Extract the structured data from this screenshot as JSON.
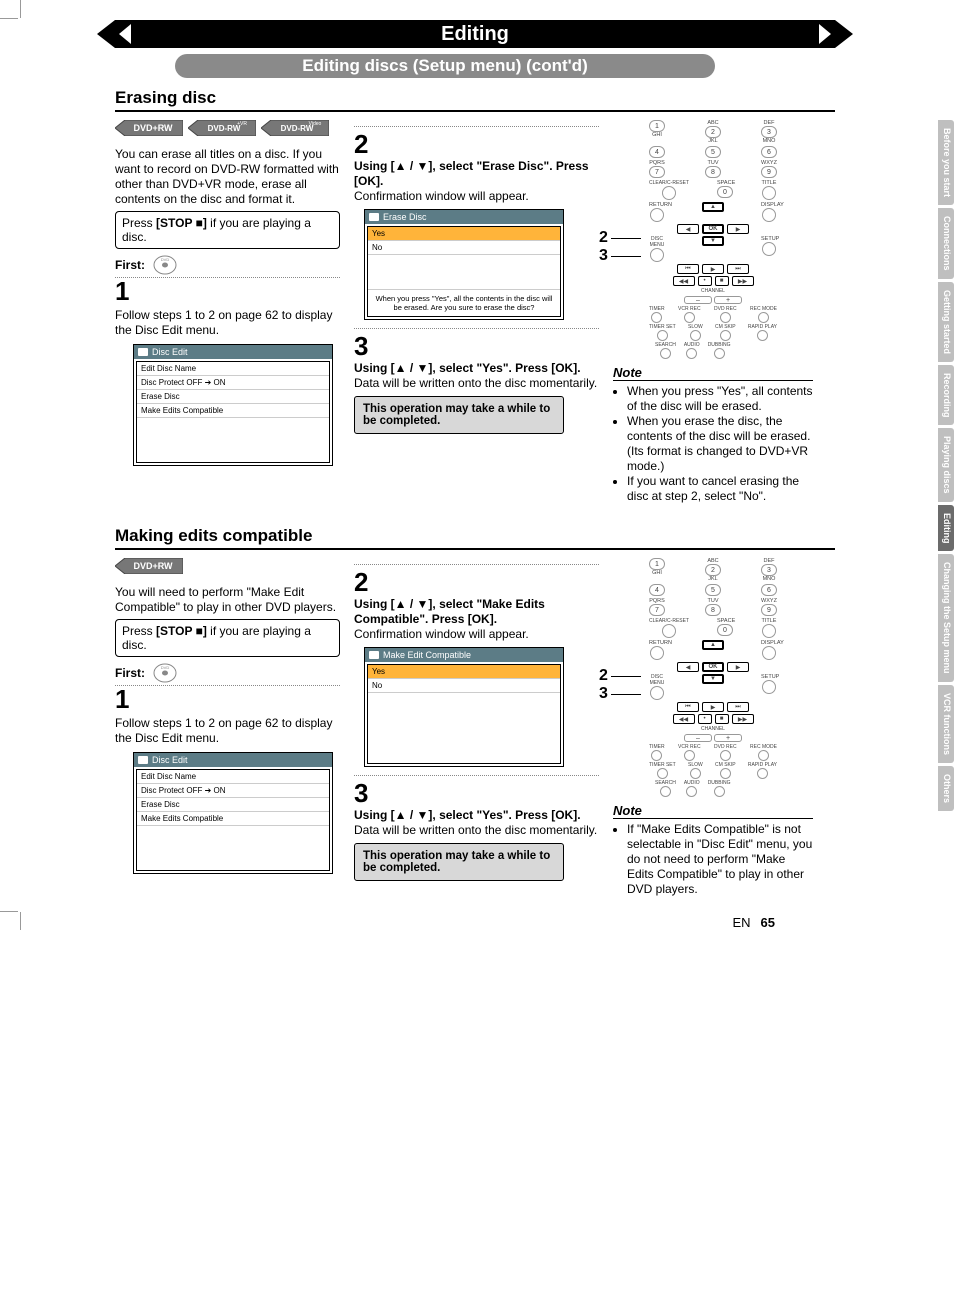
{
  "header": {
    "title": "Editing",
    "subtitle": "Editing discs (Setup menu) (cont'd)"
  },
  "section1": {
    "title": "Erasing disc",
    "badges": [
      "DVD+RW",
      "DVD-RW +VR",
      "DVD-RW Video"
    ],
    "intro": "You can erase all titles on a disc. If you want to record on DVD-RW formatted with other than DVD+VR mode, erase all contents on the disc and format it.",
    "stop_box": "Press [STOP ■] if you are playing a disc.",
    "first_label": "First:",
    "step1_num": "1",
    "step1_text": "Follow steps 1 to 2 on page 62 to display the Disc Edit menu.",
    "disc_edit_menu": {
      "title": "Disc Edit",
      "items": [
        "Edit Disc Name",
        "Disc Protect OFF  ➔  ON",
        "Erase Disc",
        "Make Edits Compatible"
      ]
    },
    "step2_num": "2",
    "step2_heading": "Using [▲ / ▼], select \"Erase Disc\". Press [OK].",
    "step2_sub": "Confirmation window will appear.",
    "erase_menu": {
      "title": "Erase Disc",
      "items": [
        "Yes",
        "No"
      ],
      "footer": "When you press \"Yes\", all the contents in the disc will be erased. Are you sure to erase the disc?"
    },
    "step3_num": "3",
    "step3_heading": "Using [▲ / ▼], select \"Yes\". Press [OK].",
    "step3_sub": "Data will be written onto the disc momentarily.",
    "op_box": "This operation may take a while to be completed.",
    "note_title": "Note",
    "notes": [
      "When you press \"Yes\", all contents of the disc will be erased.",
      "When you erase the disc, the contents of the disc will be erased. (Its format is changed to DVD+VR mode.)",
      "If you want to cancel erasing the disc at step 2, select \"No\"."
    ]
  },
  "section2": {
    "title": "Making edits compatible",
    "badges": [
      "DVD+RW"
    ],
    "intro": "You will need to perform \"Make Edit Compatible\" to play in other DVD players.",
    "stop_box": "Press [STOP ■] if you are playing a disc.",
    "first_label": "First:",
    "step1_num": "1",
    "step1_text": "Follow steps 1 to 2 on page 62 to display the Disc Edit menu.",
    "disc_edit_menu": {
      "title": "Disc Edit",
      "items": [
        "Edit Disc Name",
        "Disc Protect OFF  ➔  ON",
        "Erase Disc",
        "Make Edits Compatible"
      ]
    },
    "step2_num": "2",
    "step2_heading": "Using [▲ / ▼], select \"Make Edits Compatible\". Press [OK].",
    "step2_sub": "Confirmation window will appear.",
    "compat_menu": {
      "title": "Make Edit Compatible",
      "items": [
        "Yes",
        "No"
      ]
    },
    "step3_num": "3",
    "step3_heading": "Using [▲ / ▼], select \"Yes\". Press [OK].",
    "step3_sub": "Data will be written onto the disc momentarily.",
    "op_box": "This operation may take a while to be completed.",
    "note_title": "Note",
    "notes": [
      "If \"Make Edits Compatible\" is not selectable in \"Disc Edit\" menu, you do not need to perform \"Make Edits Compatible\" to play in other DVD players."
    ]
  },
  "remote": {
    "callout2": "2",
    "callout3": "3",
    "numpad": [
      "1",
      "2",
      "3",
      "4",
      "5",
      "6",
      "7",
      "8",
      "9",
      "0"
    ],
    "row_labels_top": [
      "",
      "ABC",
      "DEF",
      "GHI",
      "JKL",
      "MNO",
      "PQRS",
      "TUV",
      "WXYZ"
    ],
    "bottom_labels": [
      "CLEAR/C-RESET",
      "SPACE",
      "TITLE"
    ],
    "return_label": "RETURN",
    "display_label": "DISPLAY",
    "discmenu": "DISC MENU",
    "setup": "SETUP",
    "ok": "OK",
    "channel": "CHANNEL",
    "chan_minus": "–",
    "chan_plus": "+",
    "rec_row": [
      "TIMER",
      "VCR REC",
      "DVD REC",
      "REC MODE"
    ],
    "rec_row2": [
      "TIMER SET",
      "SLOW",
      "CM SKIP",
      "RAPID PLAY"
    ],
    "rec_row3": [
      "SEARCH",
      "AUDIO",
      "DUBBING"
    ]
  },
  "tabs": [
    "Before you start",
    "Connections",
    "Getting started",
    "Recording",
    "Playing discs",
    "Editing",
    "Changing the Setup menu",
    "VCR functions",
    "Others"
  ],
  "active_tab": "Editing",
  "footer": {
    "lang": "EN",
    "page": "65"
  }
}
